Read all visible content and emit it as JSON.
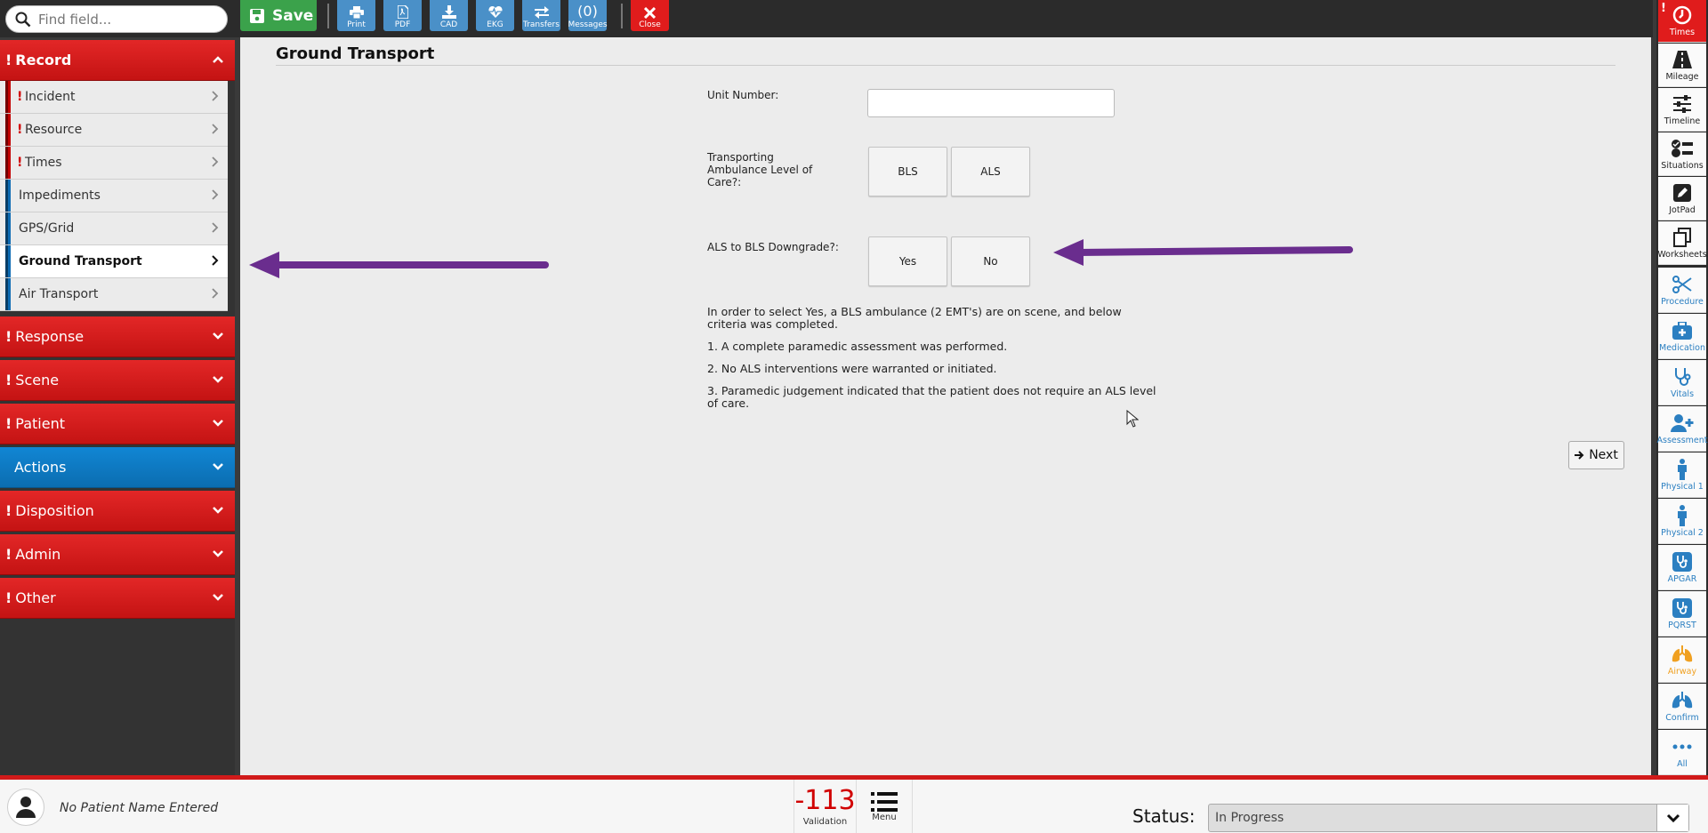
{
  "search": {
    "placeholder": "Find field..."
  },
  "toolbar": {
    "save_label": "Save",
    "print_label": "Print",
    "pdf_label": "PDF",
    "cad_label": "CAD",
    "ekg_label": "EKG",
    "transfers_label": "Transfers",
    "messages_count": "(0)",
    "messages_label": "Messages",
    "close_label": "Close"
  },
  "sidebar": {
    "record": {
      "label": "Record",
      "items": [
        {
          "label": "Incident",
          "required": true
        },
        {
          "label": "Resource",
          "required": true
        },
        {
          "label": "Times",
          "required": true
        },
        {
          "label": "Impediments",
          "required": false
        },
        {
          "label": "GPS/Grid",
          "required": false
        },
        {
          "label": "Ground Transport",
          "required": false,
          "active": true
        },
        {
          "label": "Air Transport",
          "required": false
        }
      ]
    },
    "sections": [
      {
        "label": "Response",
        "required": true
      },
      {
        "label": "Scene",
        "required": true
      },
      {
        "label": "Patient",
        "required": true
      },
      {
        "label": "Actions",
        "required": false
      },
      {
        "label": "Disposition",
        "required": true
      },
      {
        "label": "Admin",
        "required": true
      },
      {
        "label": "Other",
        "required": true
      }
    ]
  },
  "main": {
    "title": "Ground Transport",
    "unit_number_label": "Unit Number:",
    "unit_number_value": "",
    "level_of_care_label": "Transporting Ambulance Level of Care?:",
    "level_options": [
      "BLS",
      "ALS"
    ],
    "downgrade_label": "ALS to BLS Downgrade?:",
    "downgrade_options": [
      "Yes",
      "No"
    ],
    "info": [
      "In order to select Yes, a BLS ambulance (2 EMT's) are on scene, and below criteria was completed.",
      "1. A complete paramedic assessment was performed.",
      "2. No ALS interventions were warranted or initiated.",
      "3. Paramedic judgement indicated that the patient does not require an ALS level of care."
    ],
    "next_label": "Next"
  },
  "rail": [
    {
      "label": "Times",
      "icon": "clock-icon"
    },
    {
      "label": "Mileage",
      "icon": "road-icon"
    },
    {
      "label": "Timeline",
      "icon": "sliders-icon"
    },
    {
      "label": "Situations",
      "icon": "checklist-icon"
    },
    {
      "label": "JotPad",
      "icon": "pencil-icon"
    },
    {
      "label": "Worksheets",
      "icon": "clipboard-icon"
    },
    {
      "label": "Procedure",
      "icon": "scissors-icon"
    },
    {
      "label": "Medication",
      "icon": "medkit-icon"
    },
    {
      "label": "Vitals",
      "icon": "stethoscope-icon"
    },
    {
      "label": "Assessment",
      "icon": "user-plus-icon"
    },
    {
      "label": "Physical 1",
      "icon": "body-icon"
    },
    {
      "label": "Physical 2",
      "icon": "body-icon"
    },
    {
      "label": "APGAR",
      "icon": "stethoscope-icon"
    },
    {
      "label": "PQRST",
      "icon": "stethoscope-icon"
    },
    {
      "label": "Airway",
      "icon": "lungs-icon"
    },
    {
      "label": "Confirm",
      "icon": "lungs-icon"
    },
    {
      "label": "All",
      "icon": "ellipsis-icon"
    }
  ],
  "footer": {
    "patient_name": "No Patient Name Entered",
    "validation_count": "-113",
    "validation_label": "Validation",
    "menu_label": "Menu",
    "status_label": "Status:",
    "status_value": "In Progress"
  },
  "colors": {
    "required_red": "#e01c1c",
    "actions_blue": "#0b7ac4",
    "save_green": "#3ba24b",
    "tool_blue": "#4a90c8",
    "annotation_purple": "#6a2d8e"
  }
}
